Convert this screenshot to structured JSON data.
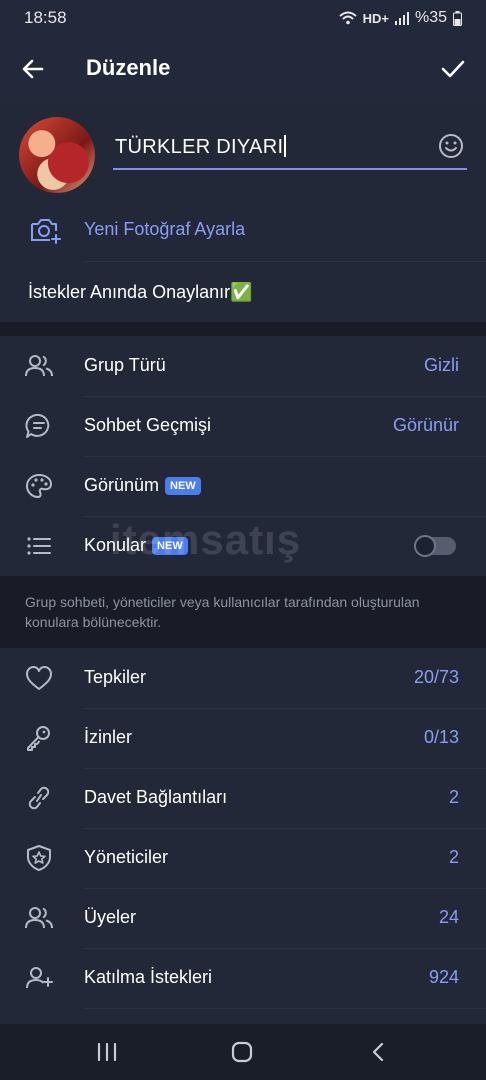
{
  "status_bar": {
    "time": "18:58",
    "network": "HD+",
    "battery": "%35",
    "icons": [
      "wifi-icon",
      "signal-icon",
      "battery-icon"
    ]
  },
  "app_bar": {
    "title": "Düzenle",
    "back_icon": "arrow-left-icon",
    "confirm_icon": "check-icon"
  },
  "profile": {
    "group_name": "TÜRKLER DIYARI",
    "new_photo_label": "Yeni Fotoğraf Ayarla",
    "description": "İstekler Anında Onaylanır✅"
  },
  "settings": [
    {
      "label": "Grup Türü",
      "value": "Gizli",
      "icon": "users-icon"
    },
    {
      "label": "Sohbet Geçmişi",
      "value": "Görünür",
      "icon": "chat-bubble-icon"
    },
    {
      "label": "Görünüm",
      "badge": "NEW",
      "icon": "palette-icon"
    },
    {
      "label": "Konular",
      "badge": "NEW",
      "icon": "list-icon",
      "toggle": false
    }
  ],
  "topics_info": "Grup sohbeti, yöneticiler veya kullanıcılar tarafından oluşturulan konulara bölünecektir.",
  "manage": [
    {
      "label": "Tepkiler",
      "value": "20/73",
      "icon": "heart-icon"
    },
    {
      "label": "İzinler",
      "value": "0/13",
      "icon": "key-icon"
    },
    {
      "label": "Davet Bağlantıları",
      "value": "2",
      "icon": "link-icon"
    },
    {
      "label": "Yöneticiler",
      "value": "2",
      "icon": "shield-star-icon"
    },
    {
      "label": "Üyeler",
      "value": "24",
      "icon": "users-icon"
    },
    {
      "label": "Katılma İstekleri",
      "value": "924",
      "icon": "user-plus-icon"
    }
  ],
  "watermark": "itemsatış",
  "colors": {
    "accent": "#8b9cf4",
    "background": "#1e2230",
    "badge": "#4b7df0"
  }
}
